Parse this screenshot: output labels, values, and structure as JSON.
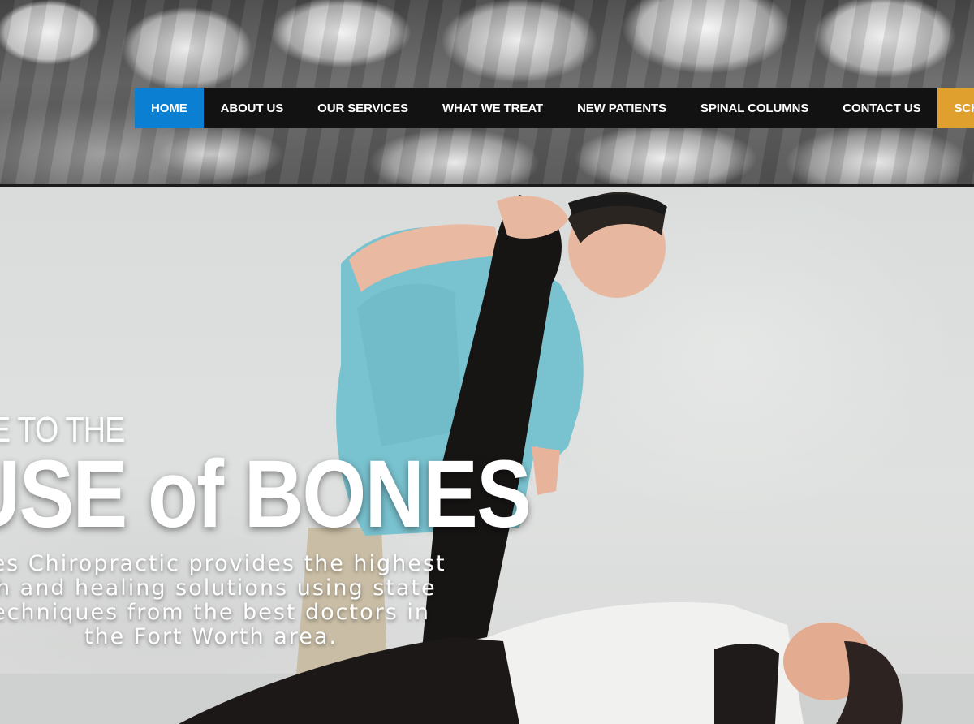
{
  "nav": {
    "items": [
      {
        "label": "HOME",
        "state": "active"
      },
      {
        "label": "ABOUT US"
      },
      {
        "label": "OUR SERVICES"
      },
      {
        "label": "WHAT WE TREAT"
      },
      {
        "label": "NEW PATIENTS"
      },
      {
        "label": "SPINAL COLUMNS"
      },
      {
        "label": "CONTACT US"
      },
      {
        "label": "SCHED",
        "state": "cta"
      }
    ]
  },
  "hero": {
    "line1": "E TO THE",
    "line2": "USE of BONES",
    "description": [
      "nes Chiropractic provides the highest",
      "th and healing solutions using state",
      "echniques from the best doctors in",
      "the Fort Worth area."
    ]
  },
  "colors": {
    "nav_bg": "#121212",
    "active": "#0b7fd1",
    "cta": "#e0a02e",
    "text": "#ffffff"
  }
}
